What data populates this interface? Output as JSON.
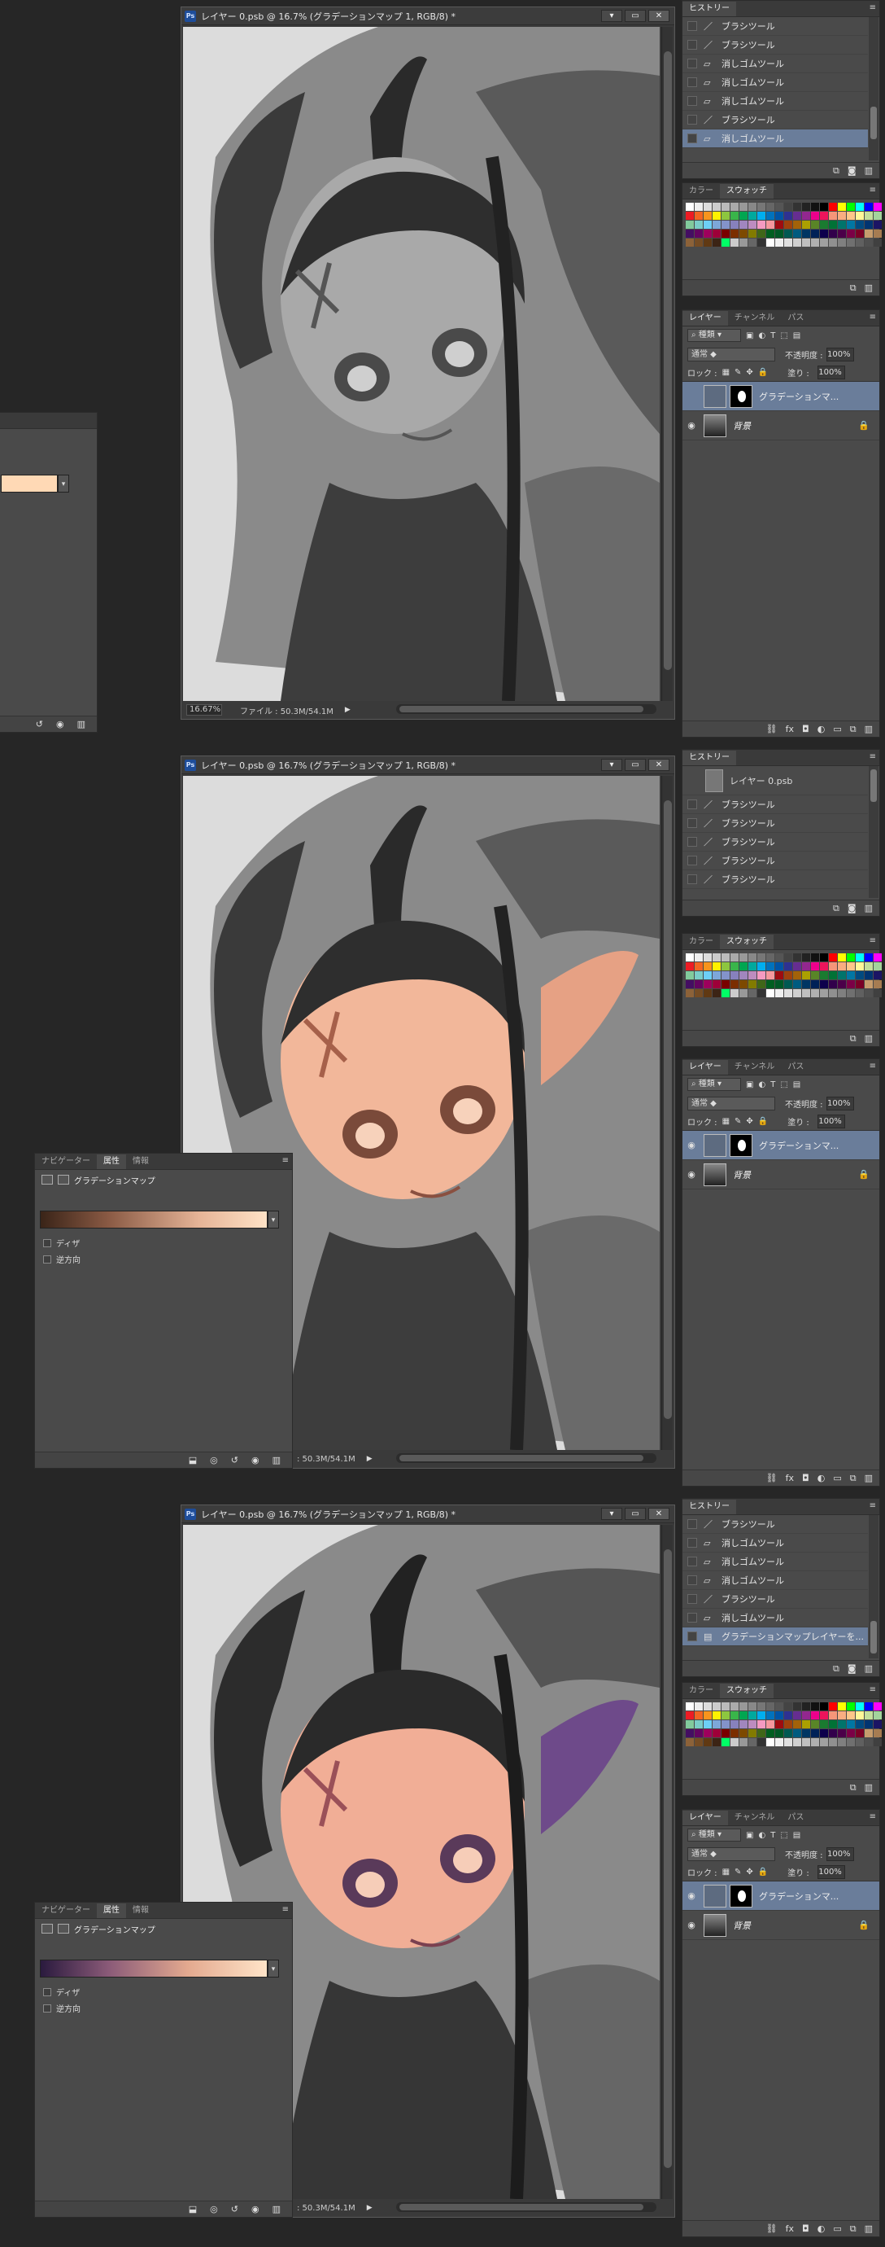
{
  "document": {
    "title": "レイヤー 0.psb @ 16.7% (グラデーションマップ 1, RGB/8) *",
    "zoom": "16.67%",
    "file_info": "ファイル : 50.3M/54.1M",
    "file_info_short": ": 50.3M/54.1M",
    "window_buttons": {
      "minimize": "▾",
      "restore": "▭",
      "close": "✕"
    }
  },
  "history": {
    "tab": "ヒストリー",
    "snapshot": "レイヤー 0.psb",
    "states_1": [
      "ブラシツール",
      "ブラシツール",
      "消しゴムツール",
      "消しゴムツール",
      "消しゴムツール",
      "ブラシツール",
      "消しゴムツール"
    ],
    "states_2": [
      "ブラシツール",
      "ブラシツール",
      "ブラシツール",
      "ブラシツール",
      "ブラシツール"
    ],
    "states_3": [
      "ブラシツール",
      "消しゴムツール",
      "消しゴムツール",
      "消しゴムツール",
      "ブラシツール",
      "消しゴムツール",
      "グラデーションマップレイヤーを..."
    ]
  },
  "swatches_panel": {
    "tab_color": "カラー",
    "tab_swatches": "スウォッチ",
    "colors": [
      "#ffffff",
      "#eeeeee",
      "#dddddd",
      "#cccccc",
      "#bbbbbb",
      "#aaaaaa",
      "#999999",
      "#888888",
      "#777777",
      "#666666",
      "#555555",
      "#444444",
      "#333333",
      "#222222",
      "#111111",
      "#000000",
      "#ff0000",
      "#ffff00",
      "#00ff00",
      "#00ffff",
      "#0000ff",
      "#ff00ff",
      "#ed1c24",
      "#f26522",
      "#f7941d",
      "#fff200",
      "#8dc63f",
      "#39b54a",
      "#00a651",
      "#00a99d",
      "#00aeef",
      "#0072bc",
      "#0054a6",
      "#2e3192",
      "#662d91",
      "#92278f",
      "#ec008c",
      "#ed145b",
      "#f69679",
      "#f9ad81",
      "#fdc689",
      "#fff799",
      "#c4df9b",
      "#a3d39c",
      "#82ca9c",
      "#7accc8",
      "#6dcff6",
      "#7da7d9",
      "#8393ca",
      "#8781bd",
      "#a186be",
      "#bd8cbf",
      "#f49ac1",
      "#f5989d",
      "#9e0b0f",
      "#a0410d",
      "#a36209",
      "#aba000",
      "#598527",
      "#1a7b30",
      "#007236",
      "#00746b",
      "#0076a3",
      "#004a80",
      "#003471",
      "#1b1464",
      "#440e62",
      "#630460",
      "#9e005d",
      "#9e0039",
      "#790000",
      "#7b2e00",
      "#7d4900",
      "#827b00",
      "#406618",
      "#005e20",
      "#005826",
      "#005952",
      "#005b7f",
      "#003663",
      "#002157",
      "#0d004c",
      "#32004b",
      "#4b0049",
      "#7b0046",
      "#7a0026",
      "#c69c6d",
      "#a67c52",
      "#8c6239",
      "#754c24",
      "#603913",
      "#3c2415",
      "#00ff66",
      "#cccccc",
      "#999999",
      "#666666",
      "#333333",
      "#ffffff",
      "#f0f0f0",
      "#e0e0e0",
      "#d0d0d0",
      "#c0c0c0",
      "#b0b0b0",
      "#a0a0a0",
      "#909090",
      "#808080",
      "#707070",
      "#606060",
      "#505050",
      "#404040"
    ]
  },
  "layers": {
    "tab_layers": "レイヤー",
    "tab_channels": "チャンネル",
    "tab_paths": "パス",
    "kind": "種類",
    "blend_mode": "通常",
    "opacity_label": "不透明度 :",
    "opacity": "100%",
    "lock_label": "ロック :",
    "fill_label": "塗り :",
    "fill": "100%",
    "adjustment_layer": "グラデーションマ...",
    "background_layer": "背景"
  },
  "properties": {
    "tab_navigator": "ナビゲーター",
    "tab_properties": "属性",
    "tab_info": "情報",
    "title": "グラデーションマップ",
    "dither": "ディザ",
    "reverse": "逆方向",
    "gradient_1": "linear-gradient(90deg, #3a2418 0%, #8a5a44 30%, #e6b497 70%, #ffe2c6 100%)",
    "gradient_2": "linear-gradient(90deg, #2a1a3e 0%, #8a5a78 30%, #e3a98f 65%, #ffe4c8 100%)"
  }
}
